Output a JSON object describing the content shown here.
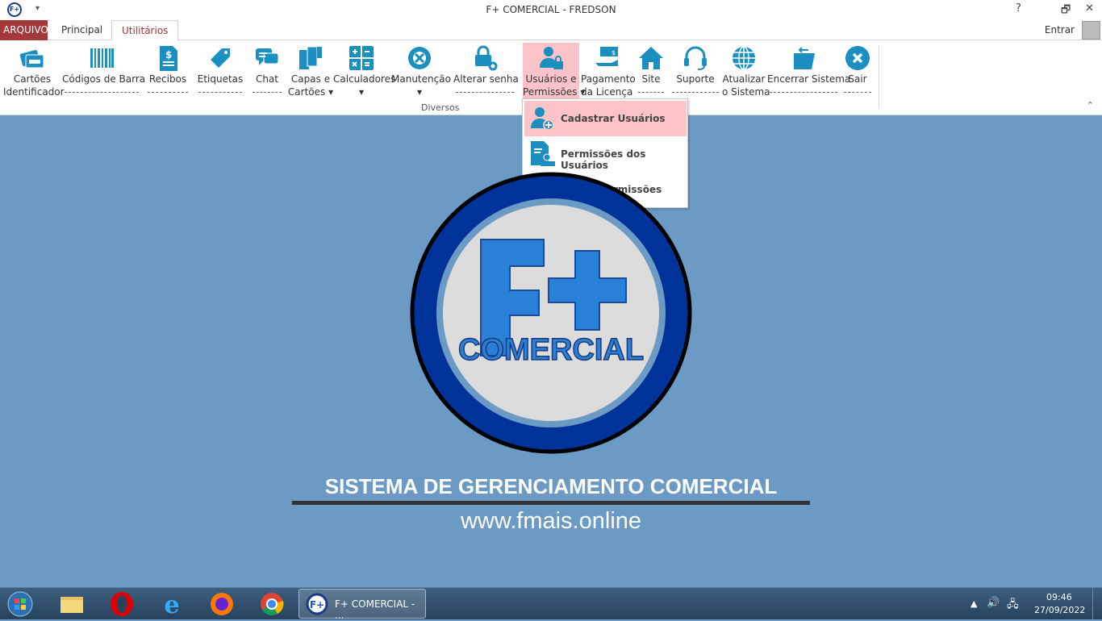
{
  "window": {
    "title": "F+ COMERCIAL - FREDSON",
    "app_icon": "F+",
    "help": "?",
    "restore": "🗗",
    "close": "✕"
  },
  "tabs": [
    {
      "label": "ARQUIVO"
    },
    {
      "label": "Principal"
    },
    {
      "label": "Utilitários",
      "active": true
    }
  ],
  "account": {
    "label": "Entrar"
  },
  "ribbon": {
    "group": "Diversos",
    "items": [
      {
        "l1": "Cartões",
        "l2": "Identificador",
        "icon": "id-card-icon"
      },
      {
        "l1": "Códigos de Barra",
        "icon": "barcode-icon"
      },
      {
        "l1": "Recibos",
        "icon": "receipt-icon"
      },
      {
        "l1": "Etiquetas",
        "icon": "tag-icon"
      },
      {
        "l1": "Chat",
        "icon": "chat-icon"
      },
      {
        "l1": "Capas e",
        "l2": "Cartões ▾",
        "icon": "covers-icon"
      },
      {
        "l1": "Calculadores",
        "l2": "▾",
        "icon": "calculator-icon"
      },
      {
        "l1": "Manutenção",
        "l2": "▾",
        "icon": "maintenance-icon"
      },
      {
        "l1": "Alterar senha",
        "icon": "lock-key-icon"
      },
      {
        "l1": "Usuários e",
        "l2": "Permissões ▾",
        "icon": "user-lock-icon",
        "selected": true
      },
      {
        "l1": "Pagamento",
        "l2": "da Licença",
        "icon": "payment-icon"
      },
      {
        "l1": "Site",
        "icon": "home-icon"
      },
      {
        "l1": "Suporte",
        "icon": "headset-icon"
      },
      {
        "l1": "Atualizar",
        "l2": "o Sistema",
        "icon": "globe-icon"
      },
      {
        "l1": "Encerrar Sistema",
        "icon": "folder-exit-icon"
      },
      {
        "l1": "Sair",
        "icon": "close-circle-icon"
      }
    ]
  },
  "dropdown": [
    {
      "label": "Cadastrar Usuários",
      "icon": "user-add-icon",
      "highlighted": true
    },
    {
      "label": "Permissões dos Usuários",
      "icon": "permissions-icon"
    },
    {
      "label": "Copiar Permissões",
      "icon": "copy-icon"
    }
  ],
  "splash": {
    "logo_text": "F+",
    "logo_sub": "COMERCIAL",
    "slogan": "SISTEMA DE GERENCIAMENTO COMERCIAL",
    "url": "www.fmais.online"
  },
  "taskbar": {
    "app_label": "F+ COMERCIAL - ...",
    "time": "09:46",
    "date": "27/09/2022"
  },
  "colors": {
    "accent": "#a4373a",
    "icon": "#1a8fc0",
    "highlight": "#fcc4c8",
    "background": "#6b9ac4"
  }
}
